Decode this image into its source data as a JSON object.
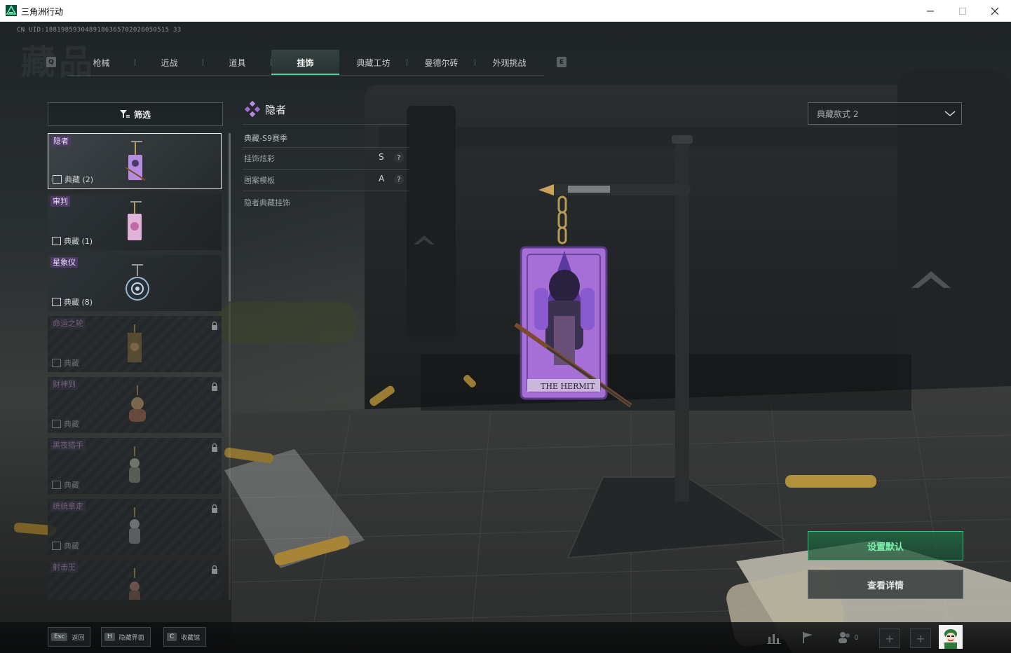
{
  "window": {
    "title": "三角洲行动"
  },
  "uid": "CN UID:1881985930489186365702026050515 33",
  "bg_title": "藏品",
  "tabs": [
    {
      "label": "枪械",
      "active": false
    },
    {
      "label": "近战",
      "active": false
    },
    {
      "label": "道具",
      "active": false
    },
    {
      "label": "挂饰",
      "active": true
    },
    {
      "label": "典藏工坊",
      "active": false
    },
    {
      "label": "曼德尔砖",
      "active": false
    },
    {
      "label": "外观挑战",
      "active": false
    }
  ],
  "tab_keys": {
    "left": "Q",
    "right": "E"
  },
  "filter": {
    "label": "筛选"
  },
  "items": [
    {
      "name": "隐者",
      "tier": "典藏 (2)",
      "locked": false,
      "selected": true,
      "color": "#b58ce0"
    },
    {
      "name": "审判",
      "tier": "典藏 (1)",
      "locked": false,
      "selected": false,
      "color": "#d9a9d0"
    },
    {
      "name": "星象仪",
      "tier": "典藏 (8)",
      "locked": false,
      "selected": false,
      "color": "#9fb6c9"
    },
    {
      "name": "命运之轮",
      "tier": "典藏",
      "locked": true,
      "selected": false,
      "color": "#b89a62"
    },
    {
      "name": "财神到",
      "tier": "典藏",
      "locked": true,
      "selected": false,
      "color": "#c9a36a"
    },
    {
      "name": "黑夜猎手",
      "tier": "典藏",
      "locked": true,
      "selected": false,
      "color": "#a8a89a"
    },
    {
      "name": "统统拿走",
      "tier": "典藏",
      "locked": true,
      "selected": false,
      "color": "#9fa4a8"
    },
    {
      "name": "射击王",
      "tier": "典藏",
      "locked": true,
      "selected": false,
      "color": "#b07a6a"
    }
  ],
  "detail": {
    "title": "隐者",
    "season": "典藏-S9赛季",
    "rows": [
      {
        "label": "挂饰炫彩",
        "grade": "S"
      },
      {
        "label": "图案模板",
        "grade": "A"
      }
    ],
    "help": "?",
    "description": "隐者典藏挂饰"
  },
  "style_select": {
    "value": "典藏款式 2"
  },
  "buttons": {
    "set_default": "设置默认",
    "view_details": "查看详情"
  },
  "card_text": "THE HERMIT",
  "bottom_hints": [
    {
      "key": "Esc",
      "label": "返回"
    },
    {
      "key": "H",
      "label": "隐藏界面"
    },
    {
      "key": "C",
      "label": "收藏馆"
    }
  ],
  "friends_count": "0",
  "colors": {
    "accent": "#4ed3a0",
    "selected_border": "#e8ecee",
    "purple": "#9a6ad0"
  }
}
